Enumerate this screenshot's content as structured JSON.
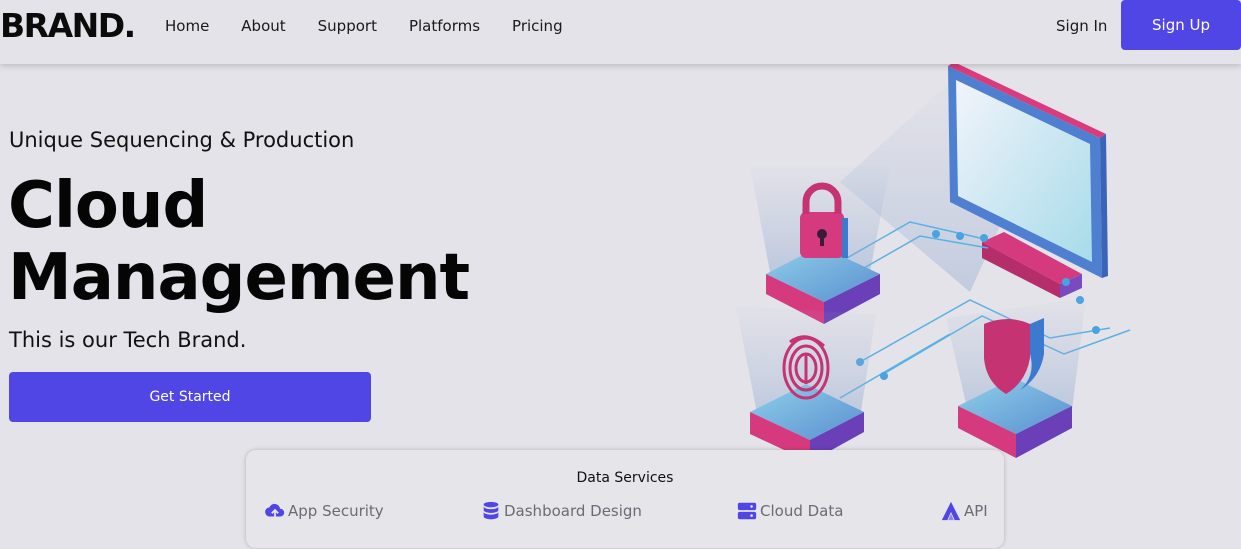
{
  "nav": {
    "brand": "BRAND.",
    "links": [
      "Home",
      "About",
      "Support",
      "Platforms",
      "Pricing"
    ],
    "sign_in": "Sign In",
    "sign_up": "Sign Up"
  },
  "hero": {
    "tagline": "Unique Sequencing & Production",
    "headline_line1": "Cloud",
    "headline_line2": "Management",
    "subtitle": "This is our Tech Brand.",
    "cta": "Get Started"
  },
  "services": {
    "title": "Data Services",
    "items": [
      {
        "label": "App Security",
        "icon": "cloud-upload-icon"
      },
      {
        "label": "Dashboard Design",
        "icon": "database-icon"
      },
      {
        "label": "Cloud Data",
        "icon": "server-icon"
      },
      {
        "label": "API",
        "icon": "api-icon"
      }
    ]
  },
  "colors": {
    "accent": "#4f46e5",
    "background": "#e4e3e9",
    "magenta": "#d63a7e",
    "blue": "#4aa3df"
  }
}
